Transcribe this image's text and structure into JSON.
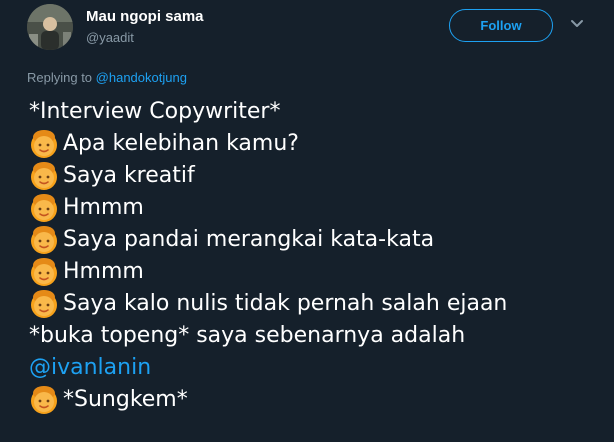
{
  "author": {
    "name": "Mau ngopi sama",
    "handle": "@yaadit"
  },
  "follow_label": "Follow",
  "reply": {
    "prefix": "Replying to ",
    "to": "@handokotjung"
  },
  "tweet": {
    "line1": "*Interview Copywriter*",
    "line2": "Apa kelebihan kamu?",
    "line3": "Saya kreatif",
    "line4": "Hmmm",
    "line5": "Saya pandai merangkai kata-kata",
    "line6": "Hmmm",
    "line7": "Saya kalo nulis tidak pernah salah ejaan",
    "line8": "*buka topeng* saya sebenarnya adalah",
    "mention": "@ivanlanin",
    "line10": "*Sungkem*"
  },
  "icons": {
    "emoji": "person-emoji",
    "menu": "chevron-down-icon"
  },
  "colors": {
    "background": "#15202b",
    "accent": "#1da1f2",
    "muted": "#8899a6",
    "text": "#ffffff"
  }
}
